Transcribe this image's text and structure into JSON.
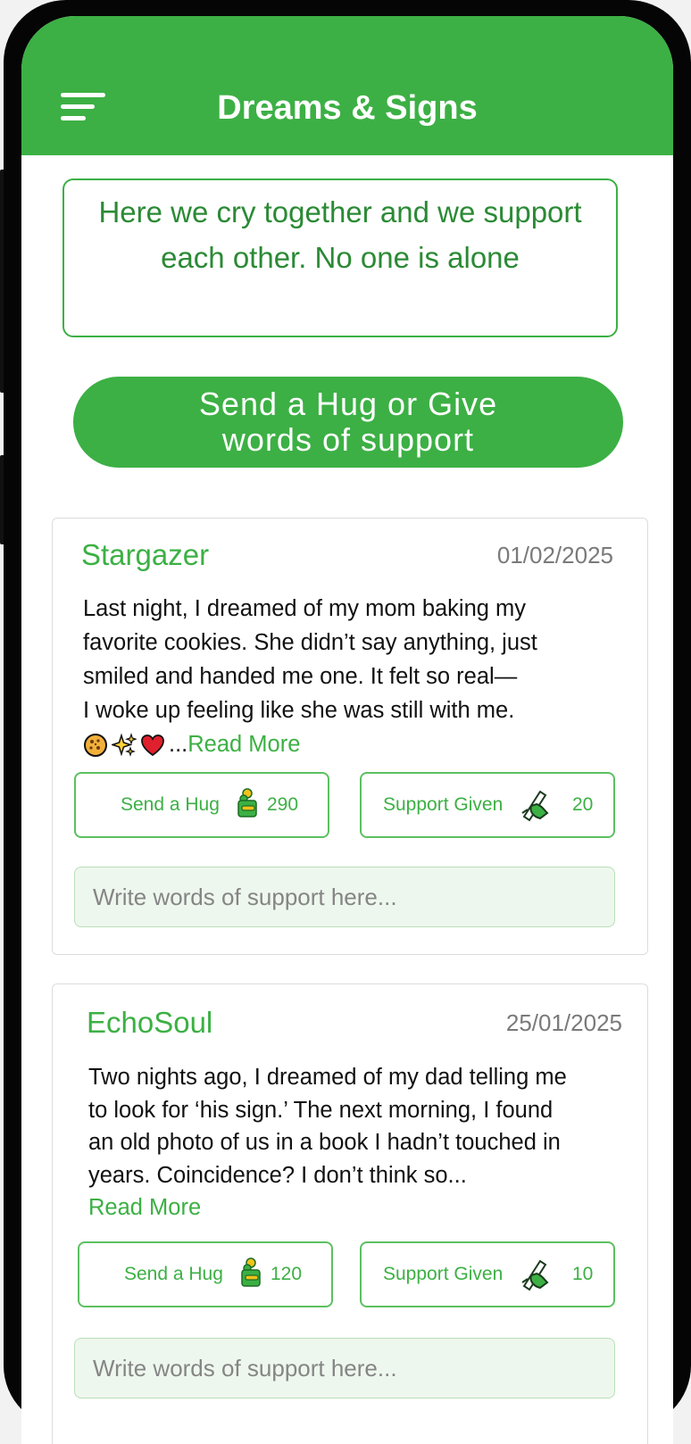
{
  "header": {
    "title": "Dreams & Signs"
  },
  "banner": {
    "text": "Here we cry together and we support each other. No one is alone"
  },
  "cta": {
    "line1": "Send a Hug or Give",
    "line2": "words of support"
  },
  "posts": [
    {
      "user": "Stargazer",
      "date": "01/02/2025",
      "lines": [
        "Last night, I dreamed of my mom baking my",
        "favorite cookies. She didn’t say anything, just",
        "smiled and handed me one. It felt so real—",
        "I woke up feeling like she was still with me."
      ],
      "emojis": [
        "cookie-icon",
        "sparkles-icon",
        "heart-icon"
      ],
      "ellipsis": "...",
      "read_more": "Read More",
      "hug_label": "Send a Hug",
      "hug_count": "290",
      "support_label": "Support Given",
      "support_count": "20",
      "input_placeholder": "Write words of support here..."
    },
    {
      "user": "EchoSoul",
      "date": "25/01/2025",
      "lines": [
        "Two nights ago, I dreamed of my dad telling me",
        "to look for ‘his sign.’ The next morning, I found",
        "an old photo of us in a book I hadn’t touched in",
        "years. Coincidence? I don’t think so..."
      ],
      "read_more": "Read More",
      "hug_label": "Send a Hug",
      "hug_count": "120",
      "support_label": "Support Given",
      "support_count": "10",
      "input_placeholder": "Write words of support here..."
    }
  ],
  "colors": {
    "primary": "#3cb044",
    "text_green": "#2b8a35",
    "input_bg": "#eef7ee"
  }
}
